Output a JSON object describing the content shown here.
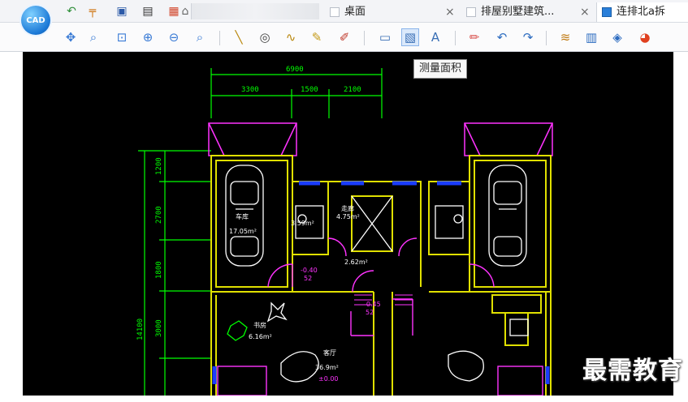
{
  "window": {
    "app_logo_text": "CAD"
  },
  "tabs": [
    {
      "label": "桌面",
      "icon": "page-icon"
    },
    {
      "label": "排屋别墅建筑...",
      "icon": "page-icon"
    },
    {
      "label": "连排北a拆",
      "icon": "cad-file-icon"
    }
  ],
  "tab_close_glyph": "×",
  "quick_toolbar": [
    "new-icon",
    "open-icon",
    "save-icon",
    "print-icon",
    "export-icon",
    "home-icon"
  ],
  "toolbar": {
    "tools": [
      "pan-icon",
      "zoom-window-icon",
      "zoom-extents-icon",
      "zoom-in-icon",
      "zoom-out-icon",
      "zoom-realtime-icon",
      "line-icon",
      "circle-icon",
      "polyline-icon",
      "sketch-icon",
      "revcloud-icon",
      "measure-length-icon",
      "measure-area-icon",
      "text-icon",
      "eraser-icon",
      "undo-icon",
      "redo-icon",
      "layers-icon",
      "blocks-icon",
      "3d-view-icon",
      "color-icon"
    ],
    "active_tool": "measure-area-icon"
  },
  "tooltip": {
    "text": "测量面积"
  },
  "drawing": {
    "dims_top": {
      "total": "6900",
      "seg1": "3300",
      "seg2": "1500",
      "seg3": "2100"
    },
    "dims_left": {
      "total": "14100",
      "seg1": "1200",
      "seg2": "2700",
      "seg3": "1800",
      "seg4": "3000"
    },
    "labels": {
      "garage_name": "车库",
      "garage_area": "17.05m²",
      "bath_area": "3.59m²",
      "hall_name": "走廊",
      "hall_area": "4.75m²",
      "stair_area": "2.62m²",
      "level_a": "-0.40",
      "level_a_sub": "52",
      "level_b": "-0.45",
      "level_b_sub": "52",
      "study_name": "书房",
      "study_area": "6.16m²",
      "living_name": "客厅",
      "living_area": "36.9m²",
      "living_level": "±0.00"
    }
  },
  "watermark": "最需教育",
  "colors": {
    "canvas_bg": "#000000",
    "wall": "#e0e000",
    "dimension": "#00ff00",
    "door": "#ff33ff",
    "window": "#1a3cff",
    "furniture": "#ffffff"
  }
}
